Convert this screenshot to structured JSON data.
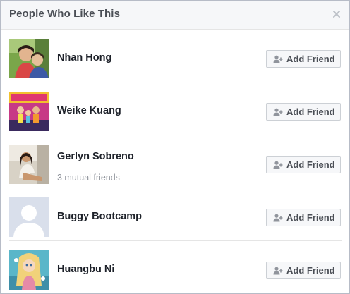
{
  "dialog": {
    "title": "People Who Like This",
    "close_icon": "close-icon"
  },
  "people": [
    {
      "name": "Nhan Hong",
      "subtext": "",
      "button_label": "Add Friend",
      "button_icon": "add-friend-icon"
    },
    {
      "name": "Weike Kuang",
      "subtext": "",
      "button_label": "Add Friend",
      "button_icon": "add-friend-icon"
    },
    {
      "name": "Gerlyn Sobreno",
      "subtext": "3 mutual friends",
      "button_label": "Add Friend",
      "button_icon": "add-friend-icon"
    },
    {
      "name": "Buggy Bootcamp",
      "subtext": "",
      "button_label": "Add Friend",
      "button_icon": "add-friend-icon"
    },
    {
      "name": "Huangbu Ni",
      "subtext": "",
      "button_label": "Add Friend",
      "button_icon": "add-friend-icon"
    }
  ],
  "colors": {
    "header_bg": "#f6f7f9",
    "name_text": "#1d2129",
    "subtext": "#90949c",
    "button_bg": "#f6f7f9",
    "button_border": "#ccd0d5",
    "default_avatar_bg": "#d9dfeb"
  }
}
